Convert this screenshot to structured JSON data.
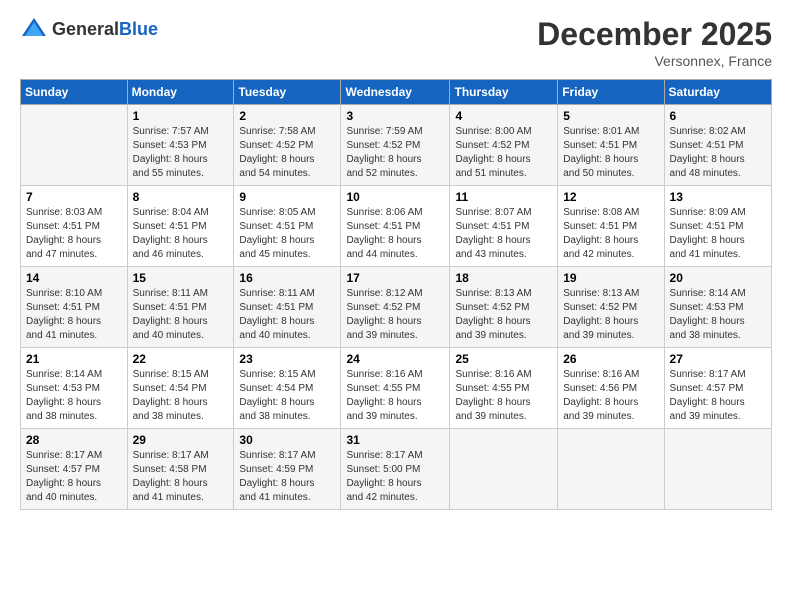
{
  "header": {
    "logo_line1": "General",
    "logo_line2": "Blue",
    "month": "December 2025",
    "location": "Versonnex, France"
  },
  "weekdays": [
    "Sunday",
    "Monday",
    "Tuesday",
    "Wednesday",
    "Thursday",
    "Friday",
    "Saturday"
  ],
  "weeks": [
    [
      {
        "day": "",
        "info": ""
      },
      {
        "day": "1",
        "info": "Sunrise: 7:57 AM\nSunset: 4:53 PM\nDaylight: 8 hours\nand 55 minutes."
      },
      {
        "day": "2",
        "info": "Sunrise: 7:58 AM\nSunset: 4:52 PM\nDaylight: 8 hours\nand 54 minutes."
      },
      {
        "day": "3",
        "info": "Sunrise: 7:59 AM\nSunset: 4:52 PM\nDaylight: 8 hours\nand 52 minutes."
      },
      {
        "day": "4",
        "info": "Sunrise: 8:00 AM\nSunset: 4:52 PM\nDaylight: 8 hours\nand 51 minutes."
      },
      {
        "day": "5",
        "info": "Sunrise: 8:01 AM\nSunset: 4:51 PM\nDaylight: 8 hours\nand 50 minutes."
      },
      {
        "day": "6",
        "info": "Sunrise: 8:02 AM\nSunset: 4:51 PM\nDaylight: 8 hours\nand 48 minutes."
      }
    ],
    [
      {
        "day": "7",
        "info": "Sunrise: 8:03 AM\nSunset: 4:51 PM\nDaylight: 8 hours\nand 47 minutes."
      },
      {
        "day": "8",
        "info": "Sunrise: 8:04 AM\nSunset: 4:51 PM\nDaylight: 8 hours\nand 46 minutes."
      },
      {
        "day": "9",
        "info": "Sunrise: 8:05 AM\nSunset: 4:51 PM\nDaylight: 8 hours\nand 45 minutes."
      },
      {
        "day": "10",
        "info": "Sunrise: 8:06 AM\nSunset: 4:51 PM\nDaylight: 8 hours\nand 44 minutes."
      },
      {
        "day": "11",
        "info": "Sunrise: 8:07 AM\nSunset: 4:51 PM\nDaylight: 8 hours\nand 43 minutes."
      },
      {
        "day": "12",
        "info": "Sunrise: 8:08 AM\nSunset: 4:51 PM\nDaylight: 8 hours\nand 42 minutes."
      },
      {
        "day": "13",
        "info": "Sunrise: 8:09 AM\nSunset: 4:51 PM\nDaylight: 8 hours\nand 41 minutes."
      }
    ],
    [
      {
        "day": "14",
        "info": "Sunrise: 8:10 AM\nSunset: 4:51 PM\nDaylight: 8 hours\nand 41 minutes."
      },
      {
        "day": "15",
        "info": "Sunrise: 8:11 AM\nSunset: 4:51 PM\nDaylight: 8 hours\nand 40 minutes."
      },
      {
        "day": "16",
        "info": "Sunrise: 8:11 AM\nSunset: 4:51 PM\nDaylight: 8 hours\nand 40 minutes."
      },
      {
        "day": "17",
        "info": "Sunrise: 8:12 AM\nSunset: 4:52 PM\nDaylight: 8 hours\nand 39 minutes."
      },
      {
        "day": "18",
        "info": "Sunrise: 8:13 AM\nSunset: 4:52 PM\nDaylight: 8 hours\nand 39 minutes."
      },
      {
        "day": "19",
        "info": "Sunrise: 8:13 AM\nSunset: 4:52 PM\nDaylight: 8 hours\nand 39 minutes."
      },
      {
        "day": "20",
        "info": "Sunrise: 8:14 AM\nSunset: 4:53 PM\nDaylight: 8 hours\nand 38 minutes."
      }
    ],
    [
      {
        "day": "21",
        "info": "Sunrise: 8:14 AM\nSunset: 4:53 PM\nDaylight: 8 hours\nand 38 minutes."
      },
      {
        "day": "22",
        "info": "Sunrise: 8:15 AM\nSunset: 4:54 PM\nDaylight: 8 hours\nand 38 minutes."
      },
      {
        "day": "23",
        "info": "Sunrise: 8:15 AM\nSunset: 4:54 PM\nDaylight: 8 hours\nand 38 minutes."
      },
      {
        "day": "24",
        "info": "Sunrise: 8:16 AM\nSunset: 4:55 PM\nDaylight: 8 hours\nand 39 minutes."
      },
      {
        "day": "25",
        "info": "Sunrise: 8:16 AM\nSunset: 4:55 PM\nDaylight: 8 hours\nand 39 minutes."
      },
      {
        "day": "26",
        "info": "Sunrise: 8:16 AM\nSunset: 4:56 PM\nDaylight: 8 hours\nand 39 minutes."
      },
      {
        "day": "27",
        "info": "Sunrise: 8:17 AM\nSunset: 4:57 PM\nDaylight: 8 hours\nand 39 minutes."
      }
    ],
    [
      {
        "day": "28",
        "info": "Sunrise: 8:17 AM\nSunset: 4:57 PM\nDaylight: 8 hours\nand 40 minutes."
      },
      {
        "day": "29",
        "info": "Sunrise: 8:17 AM\nSunset: 4:58 PM\nDaylight: 8 hours\nand 41 minutes."
      },
      {
        "day": "30",
        "info": "Sunrise: 8:17 AM\nSunset: 4:59 PM\nDaylight: 8 hours\nand 41 minutes."
      },
      {
        "day": "31",
        "info": "Sunrise: 8:17 AM\nSunset: 5:00 PM\nDaylight: 8 hours\nand 42 minutes."
      },
      {
        "day": "",
        "info": ""
      },
      {
        "day": "",
        "info": ""
      },
      {
        "day": "",
        "info": ""
      }
    ]
  ]
}
